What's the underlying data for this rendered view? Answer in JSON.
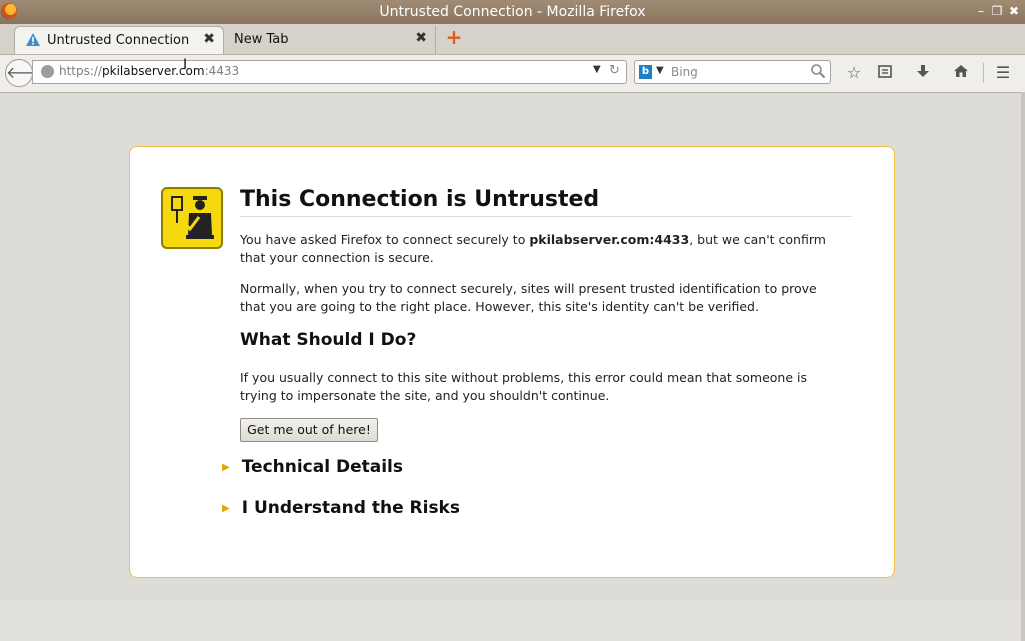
{
  "window": {
    "title": "Untrusted Connection - Mozilla Firefox"
  },
  "tabs": [
    {
      "label": "Untrusted Connection",
      "close": "✖",
      "active": true
    },
    {
      "label": "New Tab",
      "close": "✖",
      "active": false
    }
  ],
  "newtab": "+",
  "urlbar": {
    "scheme": "https://",
    "host": "pkilabserver.com",
    "port": ":4433",
    "dropdown": "▼",
    "reload": "↻"
  },
  "search": {
    "engine_icon": "b",
    "placeholder": "Bing",
    "dropdown": "▼"
  },
  "toolbar": {
    "icons": [
      "star-icon",
      "reading-list-icon",
      "download-icon",
      "home-icon",
      "menu-icon"
    ]
  },
  "error": {
    "title": "This Connection is Untrusted",
    "p1_pre": "You have asked Firefox to connect securely to ",
    "p1_host": "pkilabserver.com:4433",
    "p1_post": ", but we can't confirm that your connection is secure.",
    "p2": "Normally, when you try to connect securely, sites will present trusted identification to prove that you are going to the right place. However, this site's identity can't be verified.",
    "h2": "What Should I Do?",
    "p3": "If you usually connect to this site without problems, this error could mean that someone is trying to impersonate the site, and you shouldn't continue.",
    "button": "Get me out of here!",
    "tech_details": "Technical Details",
    "risks": "I Understand the Risks"
  },
  "colors": {
    "accent": "#f0c046",
    "badge": "#f5d90c",
    "titlebar": "#8a745e"
  }
}
